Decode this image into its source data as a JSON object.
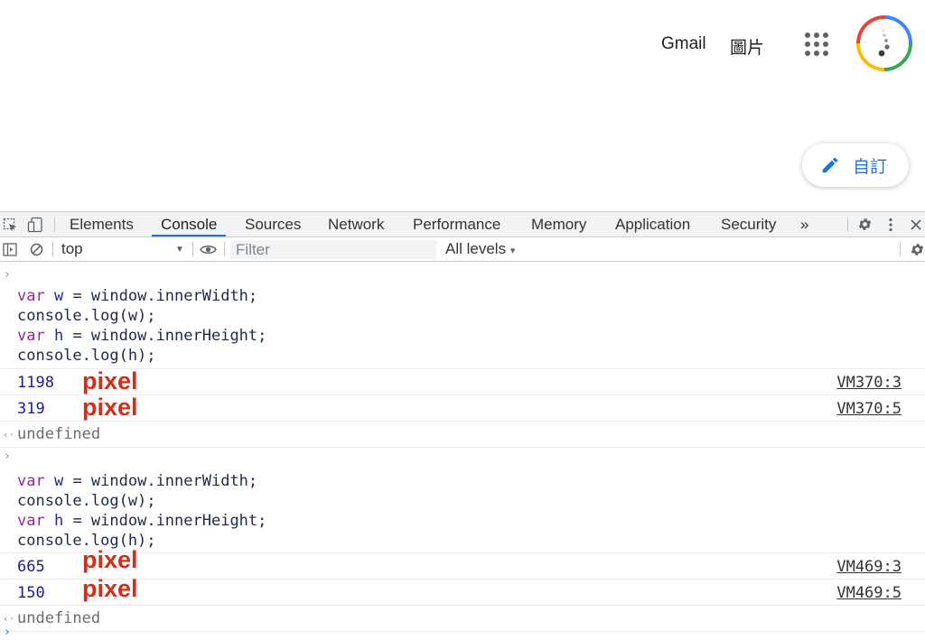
{
  "header": {
    "gmail_label": "Gmail",
    "images_label": "圖片",
    "apps_icon": "apps-grid-icon",
    "avatar_icon": "account-avatar"
  },
  "customize": {
    "label": "自訂",
    "icon": "pencil-icon",
    "accent": "#1a73e8"
  },
  "devtools": {
    "tabs": [
      "Elements",
      "Console",
      "Sources",
      "Network",
      "Performance",
      "Memory",
      "Application",
      "Security"
    ],
    "active_tab": "Console",
    "more_tabs": "»",
    "context": "top",
    "filter_placeholder": "Filter",
    "levels": "All levels"
  },
  "console": {
    "entries": [
      {
        "code": [
          "var w = window.innerWidth;",
          "console.log(w);",
          "var h = window.innerHeight;",
          "console.log(h);"
        ],
        "logs": [
          {
            "value": "1198",
            "note": "pixel",
            "source": "VM370:3"
          },
          {
            "value": "319",
            "note": "pixel",
            "source": "VM370:5"
          }
        ],
        "result": "undefined"
      },
      {
        "code": [
          "var w = window.innerWidth;",
          "console.log(w);",
          "var h = window.innerHeight;",
          "console.log(h);"
        ],
        "logs": [
          {
            "value": "665",
            "note": "pixel",
            "source": "VM469:3"
          },
          {
            "value": "150",
            "note": "pixel",
            "source": "VM469:5"
          }
        ],
        "result": "undefined"
      }
    ],
    "colors": {
      "keyword": "#a0239a",
      "number": "#1a1aa6",
      "annotation": "#d22e1a"
    }
  }
}
